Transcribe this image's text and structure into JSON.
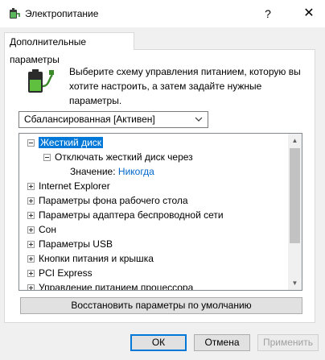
{
  "window": {
    "title": "Электропитание",
    "help_glyph": "?",
    "close_glyph": "✕"
  },
  "tab": {
    "label": "Дополнительные параметры"
  },
  "description": "Выберите схему управления питанием, которую вы хотите настроить, а затем задайте нужные параметры.",
  "scheme": {
    "selected": "Сбалансированная [Активен]"
  },
  "tree": {
    "hard_disk": {
      "label": "Жесткий диск",
      "expanded": true
    },
    "disable_hdd": {
      "label": "Отключать жесткий диск через",
      "expanded": true
    },
    "value_label": "Значение:",
    "value": "Никогда",
    "items": [
      "Internet Explorer",
      "Параметры фона рабочего стола",
      "Параметры адаптера беспроводной сети",
      "Сон",
      "Параметры USB",
      "Кнопки питания и крышка",
      "PCI Express",
      "Управление питанием процессора"
    ]
  },
  "buttons": {
    "restore": "Восстановить параметры по умолчанию",
    "ok": "ОК",
    "cancel": "Отмена",
    "apply": "Применить"
  },
  "colors": {
    "selection": "#0078d7",
    "link": "#0066cc"
  },
  "icons": {
    "app": "power-options-icon",
    "battery": "battery-plug-icon"
  }
}
